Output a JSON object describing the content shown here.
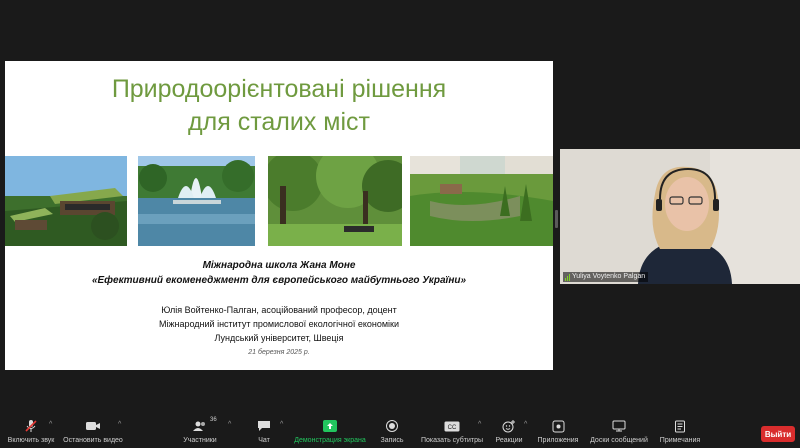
{
  "slide": {
    "title_line1": "Природоорієнтовані рішення",
    "title_line2": "для сталих міст",
    "school": "Міжнародна школа Жана Моне",
    "course": "«Ефективний екоменеджмент для європейського майбутнього України»",
    "author": "Юлія Войтенко-Палган, асоційований професор, доцент",
    "institute": "Міжнародний інститут промислової екологічної економіки",
    "university": "Лундський університет, Швеція",
    "date": "21 березня 2025 р.",
    "accent_color": "#6f9a3f"
  },
  "participant": {
    "name": "Yuliya Voytenko Palgan"
  },
  "toolbar": {
    "unmute_label": "Включить звук",
    "stop_video_label": "Остановить видео",
    "participants_label": "Участники",
    "participants_count": "36",
    "chat_label": "Чат",
    "share_screen_label": "Демонстрация экрана",
    "record_label": "Запись",
    "subtitles_label": "Показать субтитры",
    "reactions_label": "Реакции",
    "apps_label": "Приложения",
    "whiteboards_label": "Доски сообщений",
    "notes_label": "Примечания",
    "leave_label": "Выйти",
    "share_color": "#22c55e",
    "leave_color": "#d92d2d"
  }
}
